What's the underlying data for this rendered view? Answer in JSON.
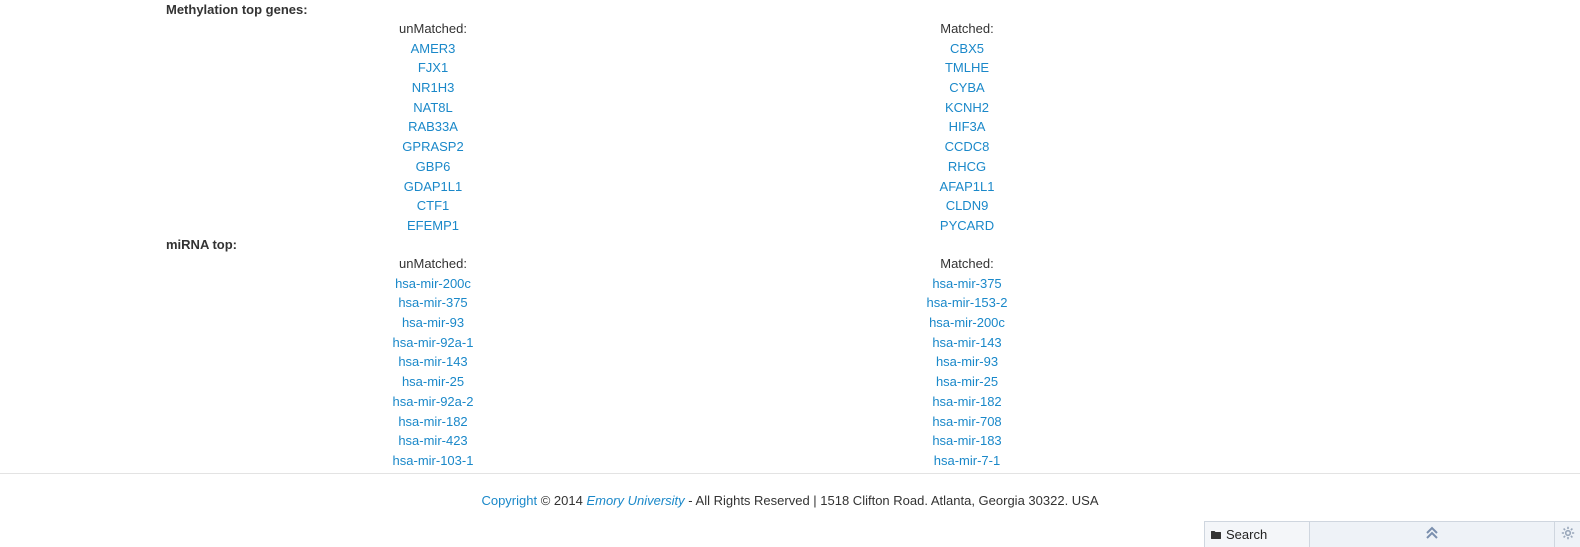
{
  "methylation": {
    "title": "Methylation top genes:",
    "unmatched": {
      "header": "unMatched:",
      "items": [
        "AMER3",
        "FJX1",
        "NR1H3",
        "NAT8L",
        "RAB33A",
        "GPRASP2",
        "GBP6",
        "GDAP1L1",
        "CTF1",
        "EFEMP1"
      ]
    },
    "matched": {
      "header": "Matched:",
      "items": [
        "CBX5",
        "TMLHE",
        "CYBA",
        "KCNH2",
        "HIF3A",
        "CCDC8",
        "RHCG",
        "AFAP1L1",
        "CLDN9",
        "PYCARD"
      ]
    }
  },
  "mirna": {
    "title": "miRNA top:",
    "unmatched": {
      "header": "unMatched:",
      "items": [
        "hsa-mir-200c",
        "hsa-mir-375",
        "hsa-mir-93",
        "hsa-mir-92a-1",
        "hsa-mir-143",
        "hsa-mir-25",
        "hsa-mir-92a-2",
        "hsa-mir-182",
        "hsa-mir-423",
        "hsa-mir-103-1"
      ]
    },
    "matched": {
      "header": "Matched:",
      "items": [
        "hsa-mir-375",
        "hsa-mir-153-2",
        "hsa-mir-200c",
        "hsa-mir-143",
        "hsa-mir-93",
        "hsa-mir-25",
        "hsa-mir-182",
        "hsa-mir-708",
        "hsa-mir-183",
        "hsa-mir-7-1"
      ]
    }
  },
  "footer": {
    "copyright_link": "Copyright",
    "year_text": " © 2014 ",
    "university_link": "Emory University",
    "rest_text": " - All Rights Reserved | 1518 Clifton Road. Atlanta, Georgia 30322. USA"
  },
  "toolbar": {
    "search_label": "Search",
    "search_icon": "folder-icon",
    "up_icon": "double-chevron-up-icon",
    "settings_icon": "gear-icon"
  },
  "colors": {
    "link": "#1a88c9",
    "text": "#333333"
  }
}
